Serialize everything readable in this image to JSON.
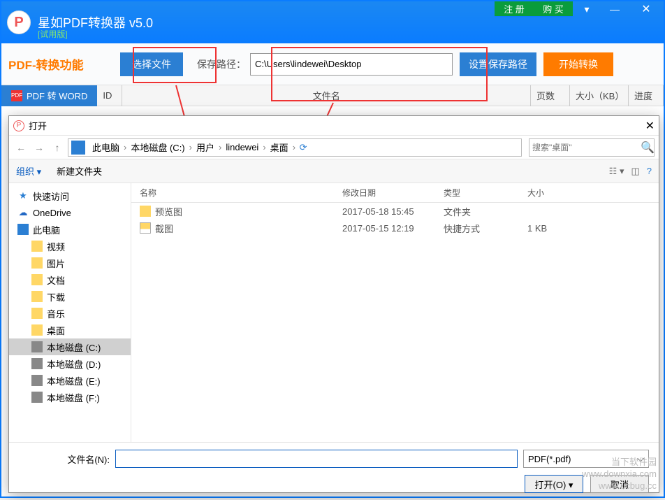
{
  "app": {
    "title": "星如PDF转换器 v5.0",
    "subtitle": "[试用版]",
    "logo_letter": "P",
    "top_links": [
      "注 册",
      "购 买"
    ]
  },
  "toolbar": {
    "func_label": "PDF-转换功能",
    "select_file": "选择文件",
    "save_path_label": "保存路径：",
    "save_path_value": "C:\\Users\\lindewei\\Desktop",
    "set_save_path": "设置保存路径",
    "start_convert": "开始转换"
  },
  "tab": {
    "active": "PDF 转  WORD",
    "headers": {
      "id": "ID",
      "filename": "文件名",
      "pages": "页数",
      "size": "大小（KB）",
      "progress": "进度"
    }
  },
  "dialog": {
    "title": "打开",
    "breadcrumb": [
      "此电脑",
      "本地磁盘 (C:)",
      "用户",
      "lindewei",
      "桌面"
    ],
    "search_placeholder": "搜索\"桌面\"",
    "organize": "组织 ▾",
    "new_folder": "新建文件夹",
    "sidebar": [
      {
        "label": "快速访问",
        "icon": "star",
        "indent": false
      },
      {
        "label": "OneDrive",
        "icon": "cloud",
        "indent": false
      },
      {
        "label": "此电脑",
        "icon": "pc",
        "indent": false
      },
      {
        "label": "视频",
        "icon": "folder",
        "indent": true
      },
      {
        "label": "图片",
        "icon": "folder",
        "indent": true
      },
      {
        "label": "文档",
        "icon": "folder",
        "indent": true
      },
      {
        "label": "下载",
        "icon": "folder",
        "indent": true
      },
      {
        "label": "音乐",
        "icon": "folder",
        "indent": true
      },
      {
        "label": "桌面",
        "icon": "folder",
        "indent": true
      },
      {
        "label": "本地磁盘 (C:)",
        "icon": "drive",
        "indent": true,
        "sel": true
      },
      {
        "label": "本地磁盘 (D:)",
        "icon": "drive",
        "indent": true
      },
      {
        "label": "本地磁盘 (E:)",
        "icon": "drive",
        "indent": true
      },
      {
        "label": "本地磁盘 (F:)",
        "icon": "drive",
        "indent": true
      }
    ],
    "columns": {
      "name": "名称",
      "date": "修改日期",
      "type": "类型",
      "size": "大小"
    },
    "rows": [
      {
        "name": "预览图",
        "date": "2017-05-18 15:45",
        "type": "文件夹",
        "size": "",
        "icon": "folder"
      },
      {
        "name": "截图",
        "date": "2017-05-15 12:19",
        "type": "快捷方式",
        "size": "1 KB",
        "icon": "shortcut"
      }
    ],
    "filename_label": "文件名(N):",
    "filename_value": "",
    "filetype": "PDF(*.pdf)",
    "open_btn": "打开(O)",
    "cancel_btn": "取消"
  },
  "watermark": {
    "l1": "当下软件园",
    "l2": "www.downxia.com",
    "l3": "www.ucbug.cc"
  }
}
